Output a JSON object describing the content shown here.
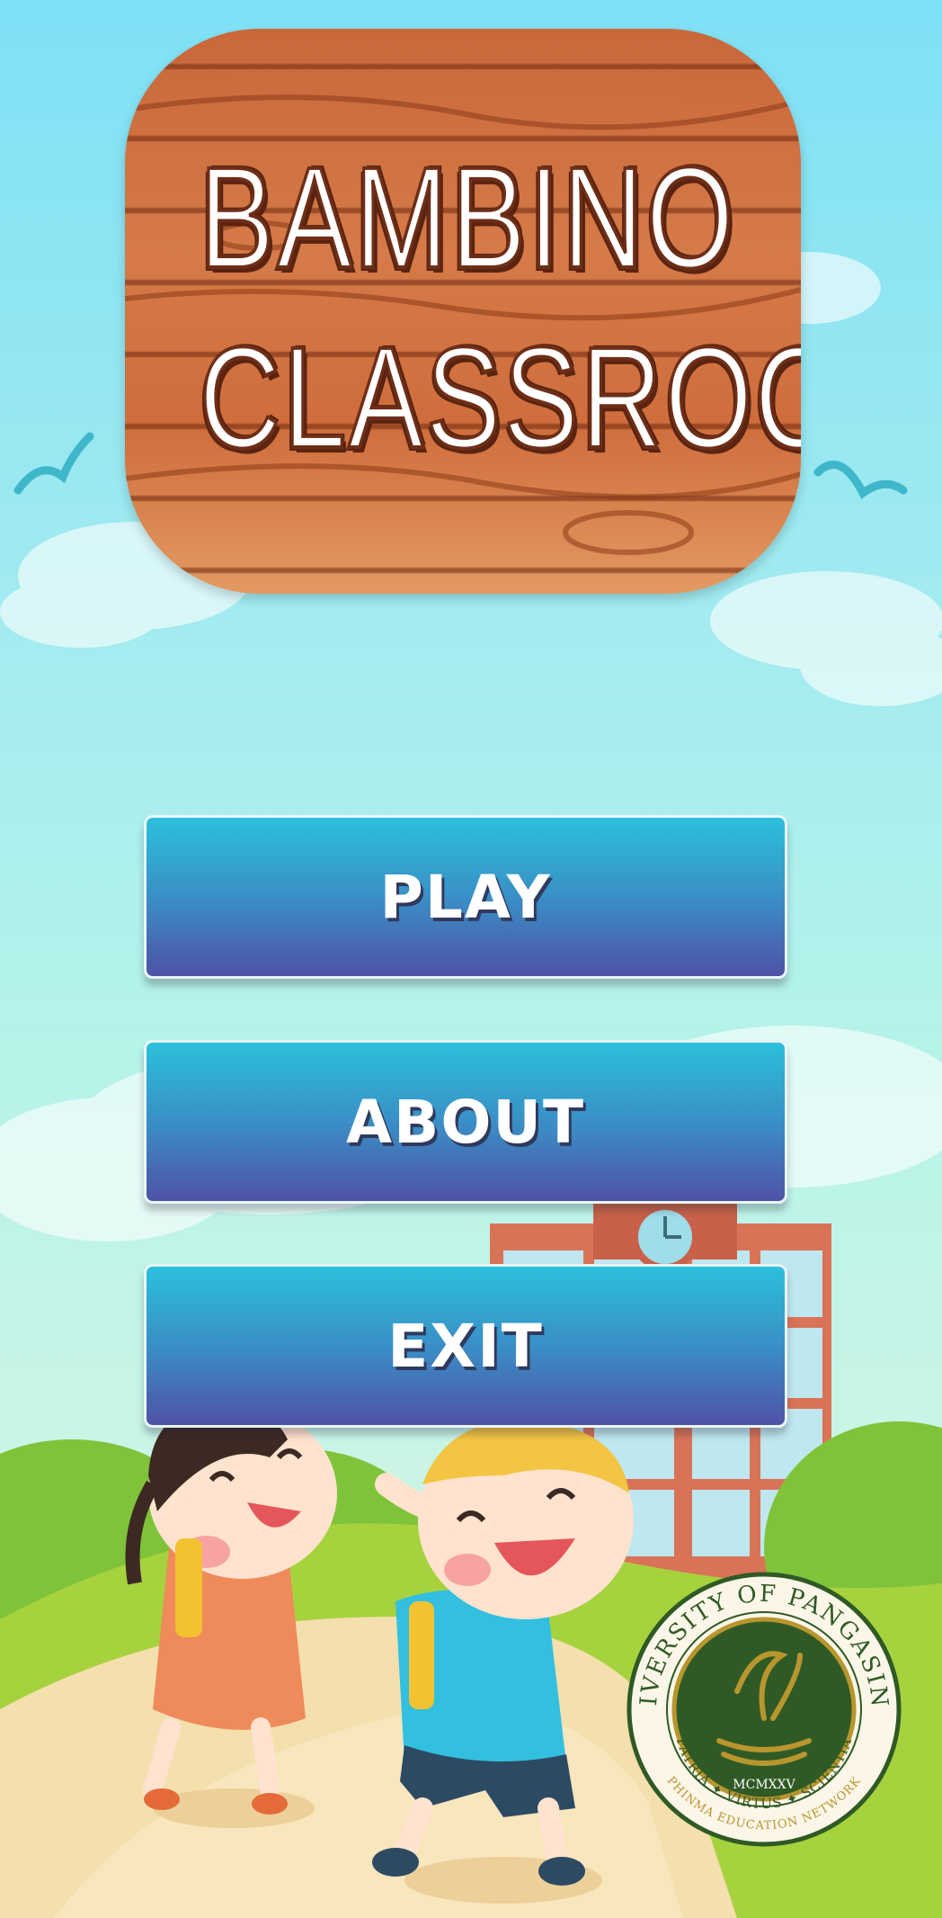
{
  "title": {
    "line1": "BAMBINO",
    "line2": "CLASSROOM"
  },
  "menu": {
    "play_label": "PLAY",
    "about_label": "ABOUT",
    "exit_label": "EXIT"
  },
  "seal": {
    "top_text": "UNIVERSITY OF PANGASINAN",
    "year": "MCMXXV",
    "motto": "PATRIA ✦ VIRTUS ✦ SCIENTIA",
    "network": "PHINMA EDUCATION NETWORK"
  },
  "colors": {
    "sky": "#7fe0f5",
    "button_top": "#2bc0dc",
    "button_bottom": "#4f52a4",
    "wood": "#c9683a",
    "seal_green": "#2f5a25",
    "seal_gold": "#b8962e"
  }
}
